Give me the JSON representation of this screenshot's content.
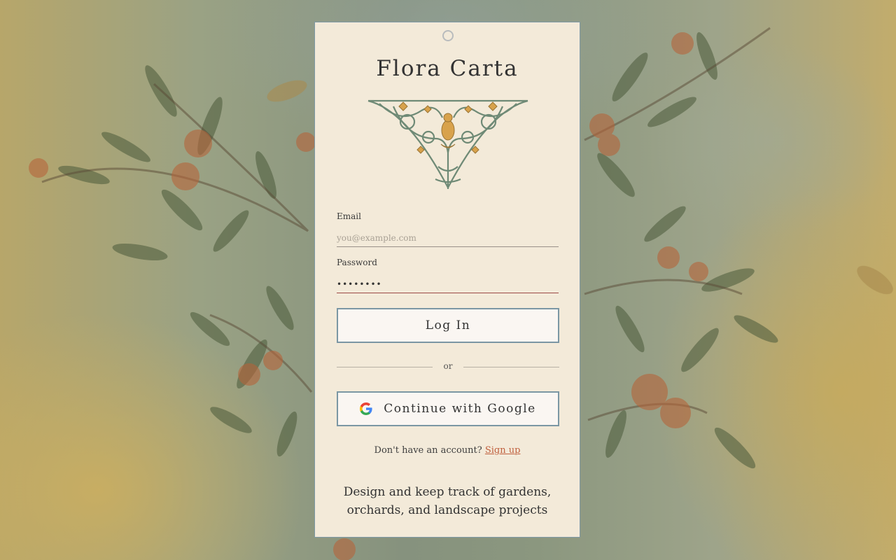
{
  "app": {
    "title": "Flora Carta",
    "tagline": "Design and keep track of gardens, orchards, and landscape projects"
  },
  "form": {
    "email_label": "Email",
    "email_placeholder": "you@example.com",
    "email_value": "",
    "password_label": "Password",
    "password_value": "••••••••",
    "login_label": "Log In",
    "divider_text": "or",
    "google_label": "Continue with Google"
  },
  "signup": {
    "prompt": "Don't have an account?",
    "link_label": "Sign up"
  },
  "colors": {
    "card_background": "#f3ead9",
    "card_border": "#7e99a6",
    "button_border": "#7b97a4",
    "link": "#c0603e",
    "password_underline": "#9c4a45"
  },
  "icons": {
    "background": "fresco-garden-background",
    "ornament": "floral-ornament-icon",
    "google": "google-icon",
    "hole": "card-hole-icon"
  }
}
